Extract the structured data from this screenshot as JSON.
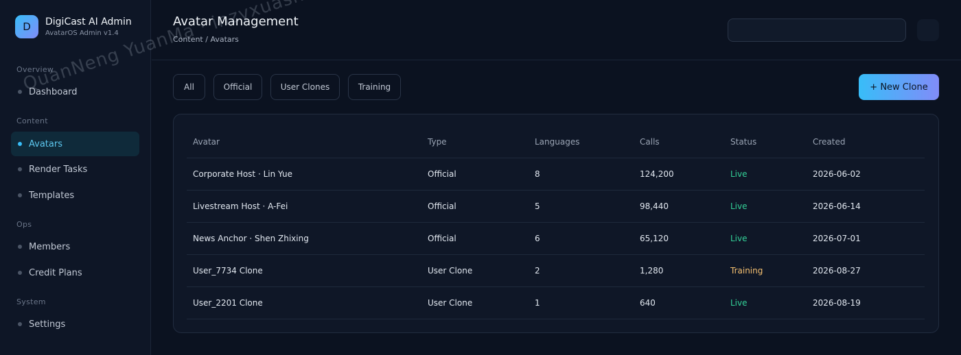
{
  "brand": {
    "logo_letter": "D",
    "title": "DigiCast AI Admin",
    "subtitle": "AvatarOS Admin v1.4"
  },
  "sidebar": {
    "sections": [
      "Overview",
      "Content",
      "Ops",
      "System"
    ],
    "items": [
      {
        "label": "Dashboard",
        "active": false
      },
      {
        "label": "Avatars",
        "active": true
      },
      {
        "label": "Render Tasks",
        "active": false
      },
      {
        "label": "Templates",
        "active": false
      },
      {
        "label": "Members",
        "active": false
      },
      {
        "label": "Credit Plans",
        "active": false
      },
      {
        "label": "Settings",
        "active": false
      }
    ]
  },
  "header": {
    "title": "Avatar Management",
    "breadcrumb": "Content / Avatars"
  },
  "filters": [
    "All",
    "Official",
    "User Clones",
    "Training"
  ],
  "new_button": "+ New Clone",
  "table": {
    "columns": [
      "Avatar",
      "Type",
      "Languages",
      "Calls",
      "Status",
      "Created"
    ],
    "rows": [
      [
        "Corporate Host · Lin Yue",
        "Official",
        "8",
        "124,200",
        "Live",
        "2026-06-02"
      ],
      [
        "Livestream Host · A-Fei",
        "Official",
        "5",
        "98,440",
        "Live",
        "2026-06-14"
      ],
      [
        "News Anchor · Shen Zhixing",
        "Official",
        "6",
        "65,120",
        "Live",
        "2026-07-01"
      ],
      [
        "User_7734 Clone",
        "User Clone",
        "2",
        "1,280",
        "Training",
        "2026-08-27"
      ],
      [
        "User_2201 Clone",
        "User Clone",
        "1",
        "640",
        "Live",
        "2026-08-19"
      ]
    ]
  },
  "colors": {
    "accent": "#38bdf8",
    "accent_end": "#818cf8",
    "live": "#34d399",
    "training": "#f5c070"
  },
  "watermark": "QuanNeng YuanMa · inzyxuashop.com"
}
